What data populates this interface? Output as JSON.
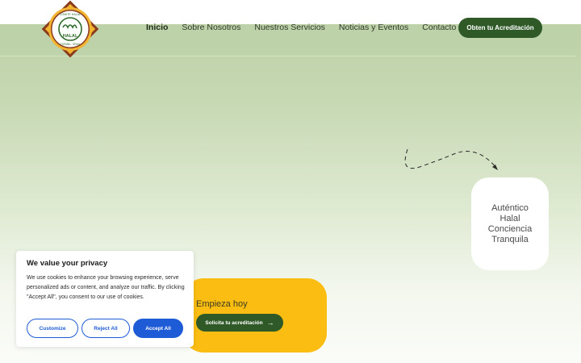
{
  "header": {
    "nav": {
      "items": [
        {
          "label": "Inicio",
          "active": true
        },
        {
          "label": "Sobre Nosotros",
          "active": false
        },
        {
          "label": "Nuestros Servicios",
          "active": false
        },
        {
          "label": "Noticias y Eventos",
          "active": false
        },
        {
          "label": "Contacto",
          "active": false
        }
      ]
    },
    "cta_label": "Obten tu Acreditación",
    "logo": {
      "top_text": "COMITE HALAL",
      "center_text": "HALAL",
      "bottom_text": "ESPAÑA - SPAIN"
    }
  },
  "hero": {
    "badge_lines": [
      "Auténtico",
      "Halal",
      "Conciencia",
      "Tranquila"
    ],
    "start": {
      "heading": "Empieza hoy",
      "button_label": "Solicita tu acreditación",
      "button_icon": "arrow-right-icon"
    }
  },
  "cookie_banner": {
    "title": "We value your privacy",
    "text": "We use cookies to enhance your browsing experience, serve personalized ads or content, and analyze our traffic. By clicking \"Accept All\", you consent to our use of cookies.",
    "buttons": {
      "customize": "Customize",
      "reject": "Reject All",
      "accept": "Accept All"
    }
  },
  "colors": {
    "brand_green": "#2f5a28",
    "accent_yellow": "#fbbd12",
    "cookie_blue": "#1e5bd6"
  }
}
